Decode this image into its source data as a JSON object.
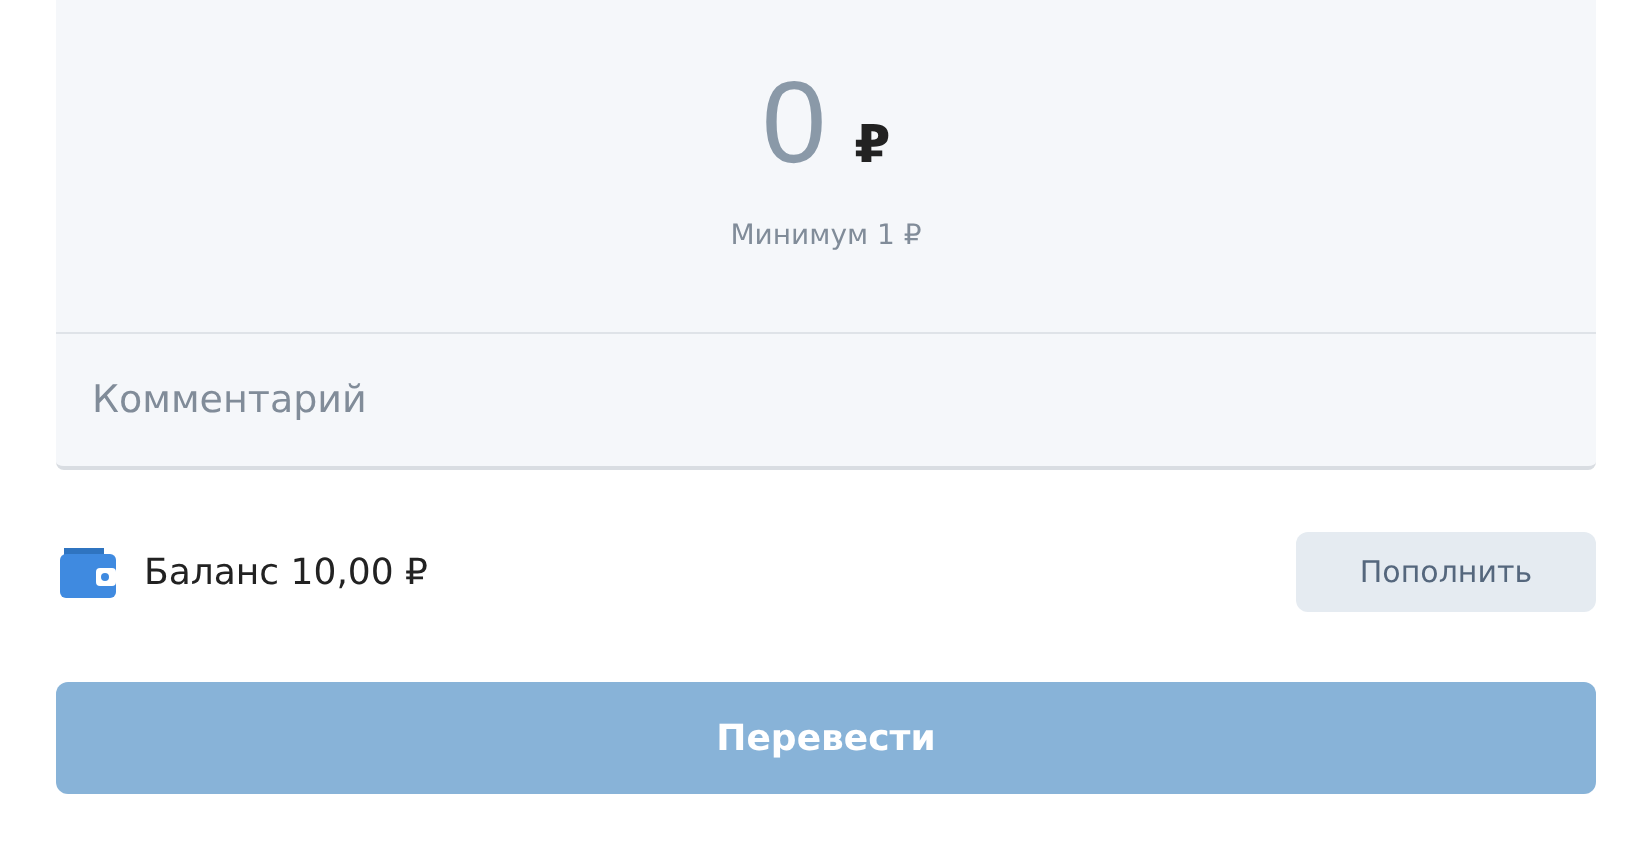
{
  "amount": {
    "value": "0",
    "currency": "₽",
    "hint": "Минимум 1 ₽"
  },
  "comment": {
    "placeholder": "Комментарий"
  },
  "balance": {
    "label": "Баланс 10,00 ₽",
    "action": "Пополнить"
  },
  "submit": {
    "label": "Перевести",
    "disabled": true
  }
}
